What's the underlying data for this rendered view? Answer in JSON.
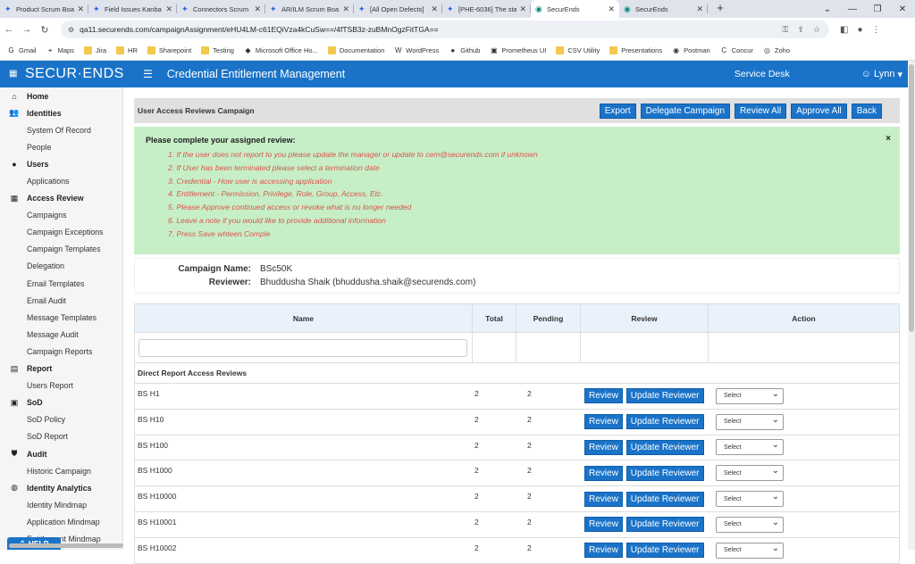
{
  "browser": {
    "tabs": [
      {
        "label": "Product Scrum Boa"
      },
      {
        "label": "Field Issues Kanba"
      },
      {
        "label": "Connectors Scrum"
      },
      {
        "label": "AR/ILM Scrum Boa"
      },
      {
        "label": "[All Open Defects]"
      },
      {
        "label": "[PHE-6036] The sta"
      },
      {
        "label": "SecurEnds"
      },
      {
        "label": "SecurEnds"
      }
    ],
    "url": "qa11.securends.com/campaignAssignment/eHU4LM-c61EQiVza4kCuSw==/4fTSB3z-zuBMnOgzFitTGA==",
    "bookmarks": [
      "Gmail",
      "Maps",
      "Jira",
      "HR",
      "Sharepoint",
      "Testing",
      "Microsoft Office Ho...",
      "Documentation",
      "WordPress",
      "Github",
      "Prometheus UI",
      "CSV Utility",
      "Presentations",
      "Postman",
      "Concur",
      "Zoho"
    ]
  },
  "header": {
    "logo": "SECUR·ENDS",
    "title": "Credential Entitlement Management",
    "service_desk": "Service Desk",
    "user": "Lynn"
  },
  "sidebar": {
    "items": [
      {
        "label": "Home",
        "type": "hd",
        "icon": "home-icon",
        "glyph": "⌂"
      },
      {
        "label": "Identities",
        "type": "hd",
        "icon": "users-icon",
        "glyph": "👥"
      },
      {
        "label": "System Of Record",
        "type": "sub"
      },
      {
        "label": "People",
        "type": "sub"
      },
      {
        "label": "Users",
        "type": "hd",
        "icon": "user-icon",
        "glyph": "●"
      },
      {
        "label": "Applications",
        "type": "sub"
      },
      {
        "label": "Access Review",
        "type": "hd",
        "icon": "grid-icon",
        "glyph": "▦"
      },
      {
        "label": "Campaigns",
        "type": "sub"
      },
      {
        "label": "Campaign Exceptions",
        "type": "sub"
      },
      {
        "label": "Campaign Templates",
        "type": "sub"
      },
      {
        "label": "Delegation",
        "type": "sub"
      },
      {
        "label": "Email Templates",
        "type": "sub"
      },
      {
        "label": "Email Audit",
        "type": "sub"
      },
      {
        "label": "Message Templates",
        "type": "sub"
      },
      {
        "label": "Message Audit",
        "type": "sub"
      },
      {
        "label": "Campaign Reports",
        "type": "sub"
      },
      {
        "label": "Report",
        "type": "hd",
        "icon": "file-icon",
        "glyph": "▤"
      },
      {
        "label": "Users Report",
        "type": "sub"
      },
      {
        "label": "SoD",
        "type": "hd",
        "icon": "sod-icon",
        "glyph": "▣"
      },
      {
        "label": "SoD Policy",
        "type": "sub"
      },
      {
        "label": "SoD Report",
        "type": "sub"
      },
      {
        "label": "Audit",
        "type": "hd",
        "icon": "shield-icon",
        "glyph": "⛊"
      },
      {
        "label": "Historic Campaign",
        "type": "sub"
      },
      {
        "label": "Identity Analytics",
        "type": "hd",
        "icon": "analytics-icon",
        "glyph": "◍"
      },
      {
        "label": "Identity Mindmap",
        "type": "sub"
      },
      {
        "label": "Application Mindmap",
        "type": "sub"
      },
      {
        "label": "Entitlement Mindmap",
        "type": "sub"
      }
    ],
    "help": "HELP"
  },
  "campaign": {
    "title": "User Access Reviews Campaign",
    "buttons": {
      "export": "Export",
      "delegate": "Delegate Campaign",
      "review_all": "Review All",
      "approve_all": "Approve All",
      "back": "Back"
    },
    "notice_heading": "Please complete your assigned review:",
    "notice_items": [
      "1. If the user does not report to you please update the manager or update to cem@securends.com if unknown",
      "2. If User has been terminated please select a termination date",
      "3. Credential - How user is accessing application",
      "4. Entitlement - Permission, Privilege, Role, Group, Access, Etc.",
      "5. Please Approve continued access or revoke what is no longer needed",
      "6. Leave a note if you would like to provide additional information",
      "7. Press Save whteen Comple"
    ],
    "close": "×",
    "name_label": "Campaign Name:",
    "name_value": "BSc50K",
    "reviewer_label": "Reviewer:",
    "reviewer_value": "Bhuddusha Shaik (bhuddusha.shaik@securends.com)"
  },
  "table": {
    "headers": {
      "name": "Name",
      "total": "Total",
      "pending": "Pending",
      "review": "Review",
      "action": "Action"
    },
    "section": "Direct Report Access Reviews",
    "review_label": "Review",
    "update_label": "Update Reviewer",
    "select_label": "Select",
    "rows": [
      {
        "name": "BS H1",
        "total": "2",
        "pending": "2"
      },
      {
        "name": "BS H10",
        "total": "2",
        "pending": "2"
      },
      {
        "name": "BS H100",
        "total": "2",
        "pending": "2"
      },
      {
        "name": "BS H1000",
        "total": "2",
        "pending": "2"
      },
      {
        "name": "BS H10000",
        "total": "2",
        "pending": "2"
      },
      {
        "name": "BS H10001",
        "total": "2",
        "pending": "2"
      },
      {
        "name": "BS H10002",
        "total": "2",
        "pending": "2"
      }
    ]
  }
}
